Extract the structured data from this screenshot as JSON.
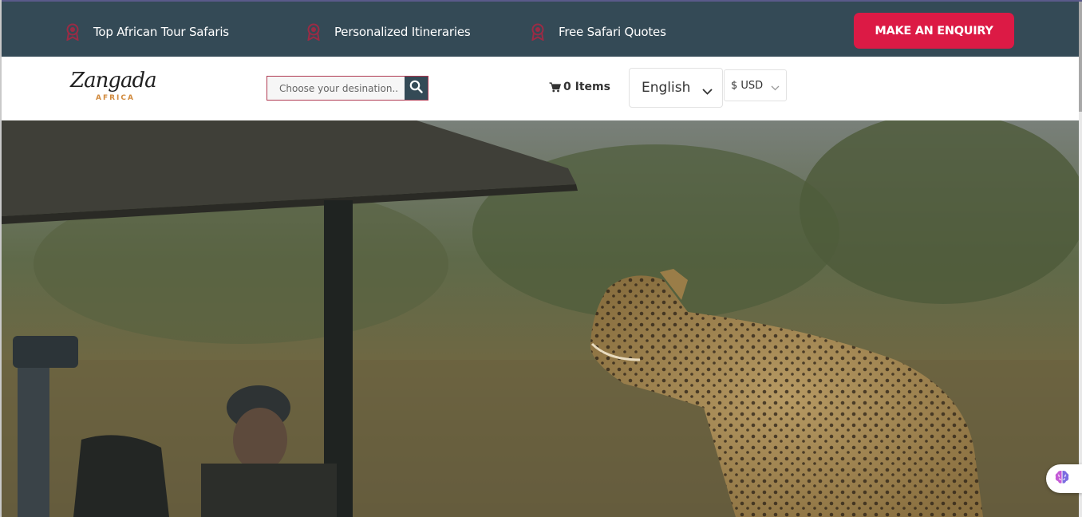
{
  "topbar": {
    "features": [
      {
        "label": "Top African Tour Safaris",
        "icon": "ribbon-icon"
      },
      {
        "label": "Personalized Itineraries",
        "icon": "ribbon-icon"
      },
      {
        "label": "Free Safari Quotes",
        "icon": "ribbon-icon"
      }
    ],
    "enquiry_label": "MAKE AN ENQUIRY"
  },
  "header": {
    "logo_text": "Zangada",
    "logo_sub": "AFRICA",
    "search_placeholder": "Choose your desination..",
    "cart_label": "0 Items",
    "language": "English",
    "currency": "$ USD"
  },
  "colors": {
    "topbar_bg": "#344a56",
    "accent": "#dc1a45",
    "logo_accent": "#d18a3d"
  },
  "hero": {
    "image": "leopard-safari-photo"
  }
}
